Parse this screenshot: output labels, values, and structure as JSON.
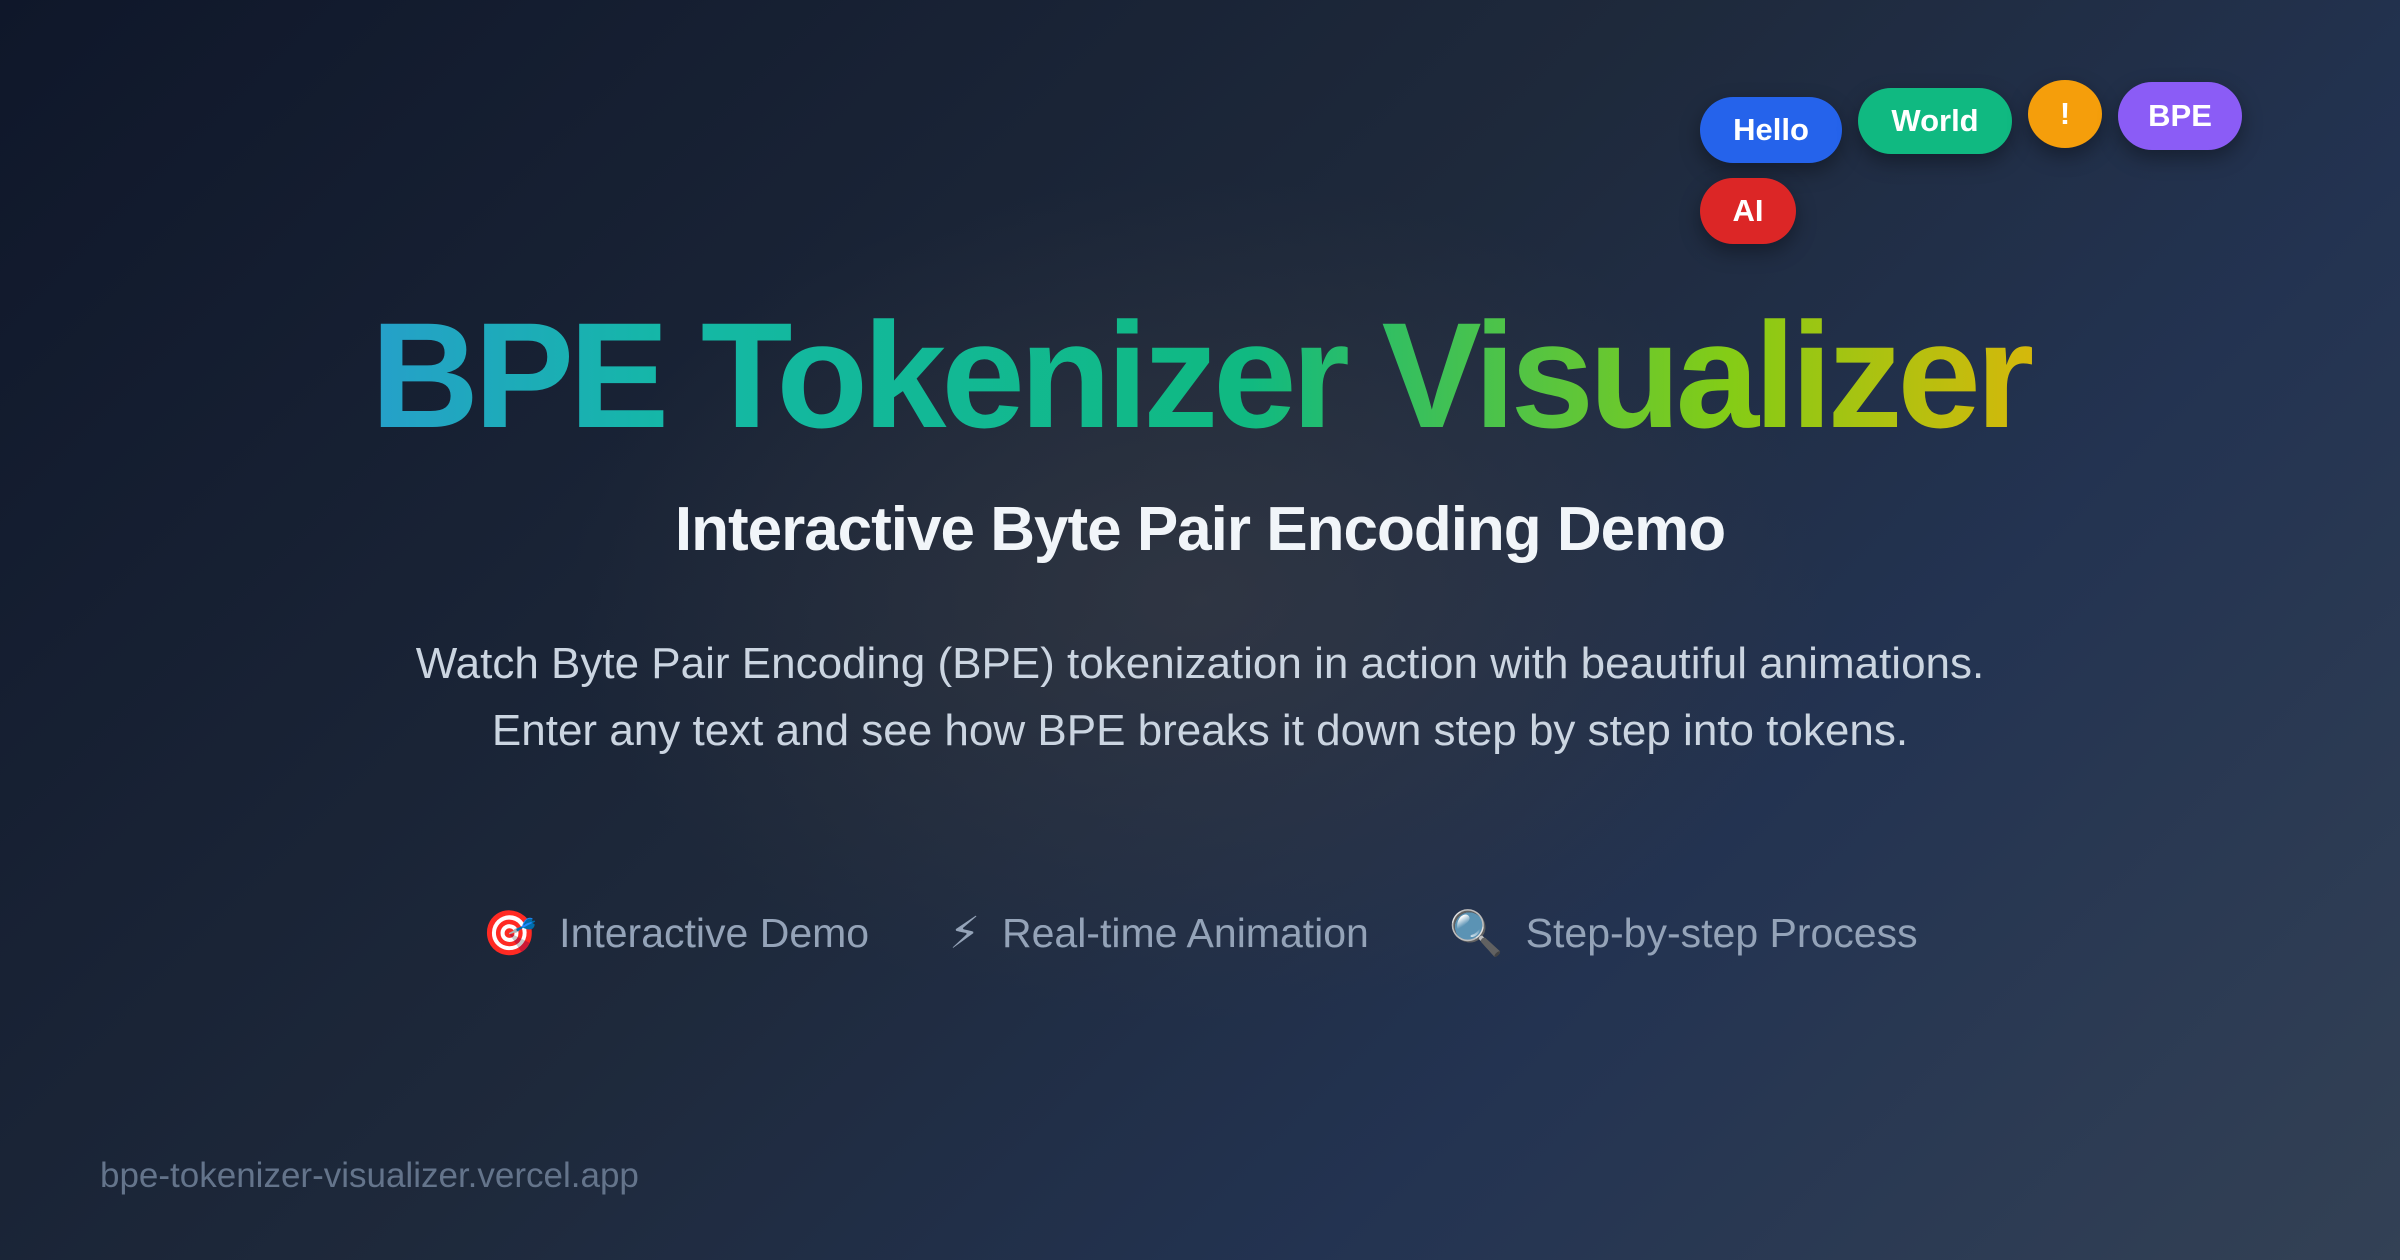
{
  "tokens": [
    {
      "label": "Hello",
      "color": "#2563eb"
    },
    {
      "label": "World",
      "color": "#10b981"
    },
    {
      "label": "!",
      "color": "#f59e0b"
    },
    {
      "label": "BPE",
      "color": "#8b5cf6"
    },
    {
      "label": "AI",
      "color": "#dc2626"
    }
  ],
  "hero": {
    "title": "BPE Tokenizer Visualizer",
    "subtitle": "Interactive Byte Pair Encoding Demo",
    "description": "Watch Byte Pair Encoding (BPE) tokenization in action with beautiful animations. Enter any text and see how BPE breaks it down step by step into tokens."
  },
  "features": [
    {
      "icon": "target-icon",
      "glyph": "🎯",
      "label": "Interactive Demo"
    },
    {
      "icon": "lightning-icon",
      "glyph": "⚡",
      "label": "Real-time Animation"
    },
    {
      "icon": "magnifier-icon",
      "glyph": "🔍",
      "label": "Step-by-step Process"
    }
  ],
  "footer": {
    "url": "bpe-tokenizer-visualizer.vercel.app"
  },
  "colors": {
    "background_start": "#0f172a",
    "background_end": "#334155",
    "title_gradient": [
      "#3b82f6",
      "#14b8a6",
      "#10b981",
      "#84cc16",
      "#eab308",
      "#f59e0b"
    ]
  }
}
